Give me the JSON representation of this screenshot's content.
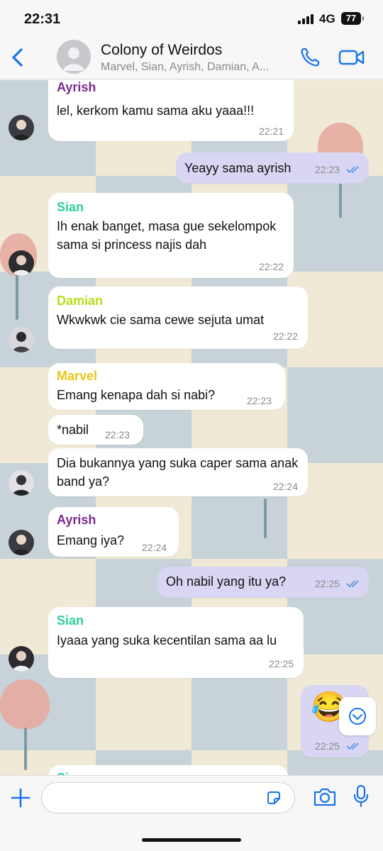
{
  "status": {
    "time": "22:31",
    "network": "4G",
    "battery": "77"
  },
  "header": {
    "title": "Colony of Weirdos",
    "subtitle": "Marvel, Sian, Ayrish, Damian, A..."
  },
  "colors": {
    "ayrish": "#7b2c8f",
    "sian": "#2fcf9a",
    "damian": "#b6e01c",
    "marvel": "#e8c618",
    "outgoing_bubble": "#d8d6f2",
    "accent": "#1a73e8"
  },
  "messages": [
    {
      "sender": "Ayrish",
      "text": "lel, kerkom kamu sama aku yaaa!!!",
      "time": "22:21"
    },
    {
      "text": "Yeayy sama ayrish",
      "time": "22:23",
      "outgoing": true
    },
    {
      "sender": "Sian",
      "text": "Ih enak banget, masa gue sekelompok sama si princess najis dah",
      "time": "22:22"
    },
    {
      "sender": "Damian",
      "text": "Wkwkwk cie sama cewe sejuta umat",
      "time": "22:22"
    },
    {
      "sender": "Marvel",
      "text": "Emang kenapa dah si nabi?",
      "time": "22:23"
    },
    {
      "text": "*nabil",
      "time": "22:23"
    },
    {
      "text": "Dia bukannya yang suka caper sama anak band ya?",
      "time": "22:24"
    },
    {
      "sender": "Ayrish",
      "text": "Emang iya?",
      "time": "22:24"
    },
    {
      "text": "Oh nabil yang itu ya?",
      "time": "22:25",
      "outgoing": true
    },
    {
      "sender": "Sian",
      "text": "Iyaaa yang suka kecentilan sama aa lu",
      "time": "22:25"
    },
    {
      "text": "😂",
      "time": "22:25",
      "outgoing": true
    }
  ],
  "composer": {
    "value": ""
  },
  "icons": [
    "back-icon",
    "phone-icon",
    "video-icon",
    "plus-icon",
    "sticker-icon",
    "camera-icon",
    "mic-icon",
    "chevron-down-icon"
  ]
}
